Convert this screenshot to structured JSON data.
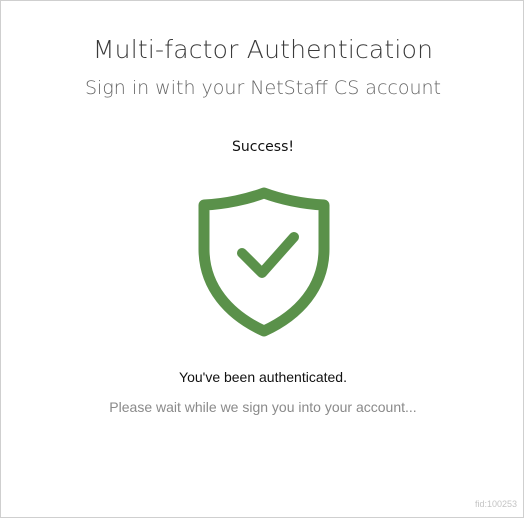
{
  "header": {
    "title": "Multi-factor Authentication",
    "subtitle": "Sign in with your NetStaff CS account"
  },
  "status": {
    "heading": "Success!",
    "icon": "shield-check-icon",
    "icon_color": "#5a914a",
    "message": "You've been authenticated.",
    "wait_text": "Please wait while we sign you into your account..."
  },
  "footer": {
    "fid": "fid:100253"
  }
}
